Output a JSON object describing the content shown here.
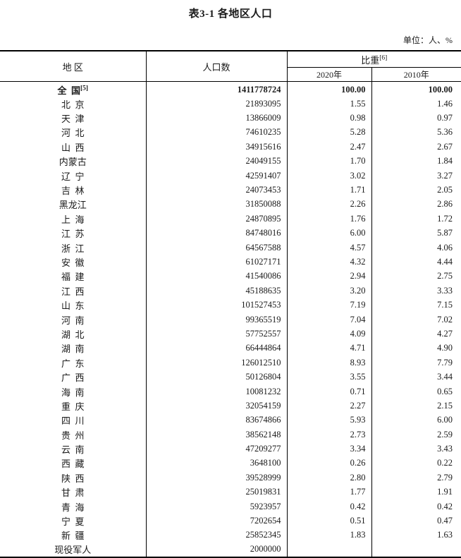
{
  "document": {
    "title": "表3-1 各地区人口",
    "unit_note": "单位：人、%"
  },
  "table": {
    "headers": {
      "region": "地  区",
      "population": "人口数",
      "ratio": "比重",
      "ratio_footnote": "[6]",
      "year_2020": "2020年",
      "year_2010": "2010年"
    },
    "rows": [
      {
        "region": "全  国",
        "footnote": "[5]",
        "population": "1411778724",
        "p2020": "100.00",
        "p2010": "100.00",
        "bold": true
      },
      {
        "region": "北  京",
        "population": "21893095",
        "p2020": "1.55",
        "p2010": "1.46"
      },
      {
        "region": "天  津",
        "population": "13866009",
        "p2020": "0.98",
        "p2010": "0.97"
      },
      {
        "region": "河  北",
        "population": "74610235",
        "p2020": "5.28",
        "p2010": "5.36"
      },
      {
        "region": "山  西",
        "population": "34915616",
        "p2020": "2.47",
        "p2010": "2.67"
      },
      {
        "region": "内蒙古",
        "population": "24049155",
        "p2020": "1.70",
        "p2010": "1.84"
      },
      {
        "region": "辽  宁",
        "population": "42591407",
        "p2020": "3.02",
        "p2010": "3.27"
      },
      {
        "region": "吉  林",
        "population": "24073453",
        "p2020": "1.71",
        "p2010": "2.05"
      },
      {
        "region": "黑龙江",
        "population": "31850088",
        "p2020": "2.26",
        "p2010": "2.86"
      },
      {
        "region": "上  海",
        "population": "24870895",
        "p2020": "1.76",
        "p2010": "1.72"
      },
      {
        "region": "江  苏",
        "population": "84748016",
        "p2020": "6.00",
        "p2010": "5.87"
      },
      {
        "region": "浙  江",
        "population": "64567588",
        "p2020": "4.57",
        "p2010": "4.06"
      },
      {
        "region": "安  徽",
        "population": "61027171",
        "p2020": "4.32",
        "p2010": "4.44"
      },
      {
        "region": "福  建",
        "population": "41540086",
        "p2020": "2.94",
        "p2010": "2.75"
      },
      {
        "region": "江  西",
        "population": "45188635",
        "p2020": "3.20",
        "p2010": "3.33"
      },
      {
        "region": "山  东",
        "population": "101527453",
        "p2020": "7.19",
        "p2010": "7.15"
      },
      {
        "region": "河  南",
        "population": "99365519",
        "p2020": "7.04",
        "p2010": "7.02"
      },
      {
        "region": "湖  北",
        "population": "57752557",
        "p2020": "4.09",
        "p2010": "4.27"
      },
      {
        "region": "湖  南",
        "population": "66444864",
        "p2020": "4.71",
        "p2010": "4.90"
      },
      {
        "region": "广  东",
        "population": "126012510",
        "p2020": "8.93",
        "p2010": "7.79"
      },
      {
        "region": "广  西",
        "population": "50126804",
        "p2020": "3.55",
        "p2010": "3.44"
      },
      {
        "region": "海  南",
        "population": "10081232",
        "p2020": "0.71",
        "p2010": "0.65"
      },
      {
        "region": "重  庆",
        "population": "32054159",
        "p2020": "2.27",
        "p2010": "2.15"
      },
      {
        "region": "四  川",
        "population": "83674866",
        "p2020": "5.93",
        "p2010": "6.00"
      },
      {
        "region": "贵  州",
        "population": "38562148",
        "p2020": "2.73",
        "p2010": "2.59"
      },
      {
        "region": "云  南",
        "population": "47209277",
        "p2020": "3.34",
        "p2010": "3.43"
      },
      {
        "region": "西  藏",
        "population": "3648100",
        "p2020": "0.26",
        "p2010": "0.22"
      },
      {
        "region": "陕  西",
        "population": "39528999",
        "p2020": "2.80",
        "p2010": "2.79"
      },
      {
        "region": "甘  肃",
        "population": "25019831",
        "p2020": "1.77",
        "p2010": "1.91"
      },
      {
        "region": "青  海",
        "population": "5923957",
        "p2020": "0.42",
        "p2010": "0.42"
      },
      {
        "region": "宁  夏",
        "population": "7202654",
        "p2020": "0.51",
        "p2010": "0.47"
      },
      {
        "region": "新  疆",
        "population": "25852345",
        "p2020": "1.83",
        "p2010": "1.63"
      },
      {
        "region": "现役军人",
        "population": "2000000",
        "p2020": "",
        "p2010": ""
      }
    ]
  }
}
